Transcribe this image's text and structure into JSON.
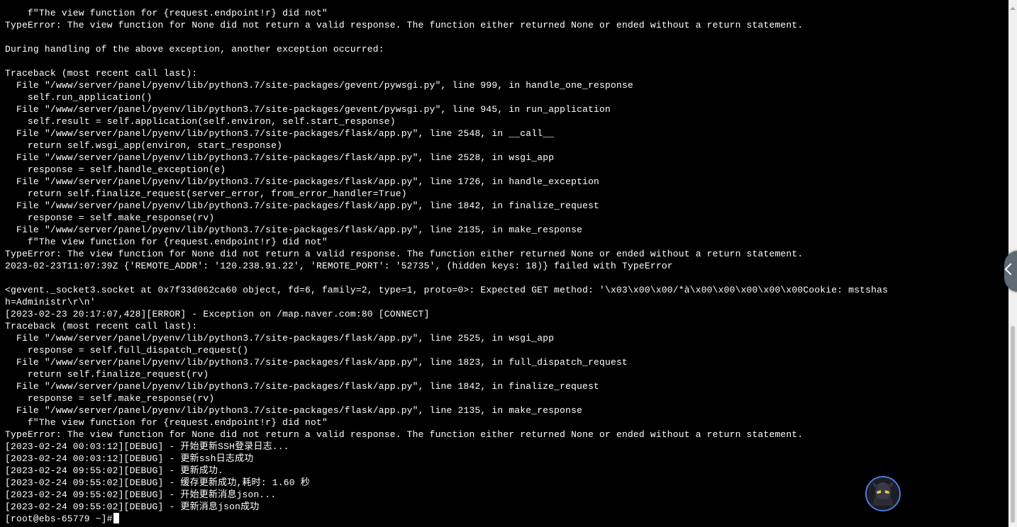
{
  "terminal": {
    "lines": [
      "    f\"The view function for {request.endpoint!r} did not\"",
      "TypeError: The view function for None did not return a valid response. The function either returned None or ended without a return statement.",
      "",
      "During handling of the above exception, another exception occurred:",
      "",
      "Traceback (most recent call last):",
      "  File \"/www/server/panel/pyenv/lib/python3.7/site-packages/gevent/pywsgi.py\", line 999, in handle_one_response",
      "    self.run_application()",
      "  File \"/www/server/panel/pyenv/lib/python3.7/site-packages/gevent/pywsgi.py\", line 945, in run_application",
      "    self.result = self.application(self.environ, self.start_response)",
      "  File \"/www/server/panel/pyenv/lib/python3.7/site-packages/flask/app.py\", line 2548, in __call__",
      "    return self.wsgi_app(environ, start_response)",
      "  File \"/www/server/panel/pyenv/lib/python3.7/site-packages/flask/app.py\", line 2528, in wsgi_app",
      "    response = self.handle_exception(e)",
      "  File \"/www/server/panel/pyenv/lib/python3.7/site-packages/flask/app.py\", line 1726, in handle_exception",
      "    return self.finalize_request(server_error, from_error_handler=True)",
      "  File \"/www/server/panel/pyenv/lib/python3.7/site-packages/flask/app.py\", line 1842, in finalize_request",
      "    response = self.make_response(rv)",
      "  File \"/www/server/panel/pyenv/lib/python3.7/site-packages/flask/app.py\", line 2135, in make_response",
      "    f\"The view function for {request.endpoint!r} did not\"",
      "TypeError: The view function for None did not return a valid response. The function either returned None or ended without a return statement.",
      "2023-02-23T11:07:39Z {'REMOTE_ADDR': '120.238.91.22', 'REMOTE_PORT': '52735', (hidden keys: 18)} failed with TypeError",
      "",
      "<gevent._socket3.socket at 0x7f33d062ca60 object, fd=6, family=2, type=1, proto=0>: Expected GET method: '\\x03\\x00\\x00/*à\\x00\\x00\\x00\\x00\\x00Cookie: mstshas",
      "h=Administr\\r\\n'",
      "[2023-02-23 20:17:07,428][ERROR] - Exception on /map.naver.com:80 [CONNECT]",
      "Traceback (most recent call last):",
      "  File \"/www/server/panel/pyenv/lib/python3.7/site-packages/flask/app.py\", line 2525, in wsgi_app",
      "    response = self.full_dispatch_request()",
      "  File \"/www/server/panel/pyenv/lib/python3.7/site-packages/flask/app.py\", line 1823, in full_dispatch_request",
      "    return self.finalize_request(rv)",
      "  File \"/www/server/panel/pyenv/lib/python3.7/site-packages/flask/app.py\", line 1842, in finalize_request",
      "    response = self.make_response(rv)",
      "  File \"/www/server/panel/pyenv/lib/python3.7/site-packages/flask/app.py\", line 2135, in make_response",
      "    f\"The view function for {request.endpoint!r} did not\"",
      "TypeError: The view function for None did not return a valid response. The function either returned None or ended without a return statement.",
      "[2023-02-24 00:03:12][DEBUG] - 开始更新SSH登录日志...",
      "[2023-02-24 00:03:12][DEBUG] - 更新ssh日志成功",
      "[2023-02-24 09:55:02][DEBUG] - 更新成功.",
      "[2023-02-24 09:55:02][DEBUG] - 缓存更新成功,耗时: 1.60 秒",
      "[2023-02-24 09:55:02][DEBUG] - 开始更新消息json...",
      "[2023-02-24 09:55:02][DEBUG] - 更新消息json成功"
    ],
    "prompt": "[root@ebs-65779 ~]#"
  },
  "icons": {
    "side_toggle": "chevron-left-icon",
    "avatar": "user-avatar-icon"
  },
  "colors": {
    "background": "#000000",
    "text": "#ffffff",
    "toggle": "#5f6b73",
    "avatar_border": "#4a7de0"
  }
}
